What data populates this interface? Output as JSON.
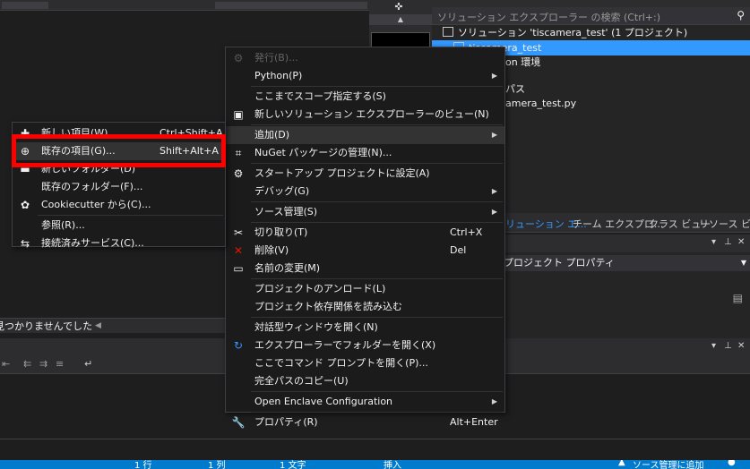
{
  "solution_explorer": {
    "search_placeholder": "ソリューション エクスプローラー の検索 (Ctrl+:)",
    "tree": [
      {
        "label": "ソリューション 'tiscamera_test' (1 プロジェクト)",
        "selected": false
      },
      {
        "label": "tiscamera_test",
        "selected": true
      },
      {
        "label": "on 環境",
        "selected": false
      },
      {
        "label": "パス",
        "selected": false
      },
      {
        "label": "amera_test.py",
        "selected": false
      }
    ]
  },
  "tool_tabs": [
    "リューション エ...",
    "チーム エクスプロ...",
    "クラス ビュー",
    "リソース ビュー"
  ],
  "properties": {
    "combo_value": "プロジェクト プロパティ"
  },
  "find_bar": {
    "text": "見つかりませんでした"
  },
  "status_bar": {
    "line": "1 行",
    "col": "1 列",
    "char": "1 文字",
    "mode": "挿入",
    "source_control": "ソース管理に追加"
  },
  "context_menu": [
    {
      "label": "発行(B)...",
      "shortcut": "",
      "icon": "publish-icon",
      "glyph": "⚙",
      "submenu": false,
      "disabled": true
    },
    {
      "label": "Python(P)",
      "shortcut": "",
      "icon": "",
      "glyph": "",
      "submenu": true,
      "disabled": false
    },
    {
      "separator": true
    },
    {
      "label": "ここまでスコープ指定する(S)",
      "shortcut": "",
      "icon": "",
      "glyph": "",
      "submenu": false,
      "disabled": false
    },
    {
      "label": "新しいソリューション エクスプローラーのビュー(N)",
      "shortcut": "",
      "icon": "new-view-icon",
      "glyph": "▣",
      "submenu": false,
      "disabled": false
    },
    {
      "separator": true
    },
    {
      "label": "追加(D)",
      "shortcut": "",
      "icon": "",
      "glyph": "",
      "submenu": true,
      "disabled": false,
      "highlighted": true
    },
    {
      "label": "NuGet パッケージの管理(N)...",
      "shortcut": "",
      "icon": "nuget-icon",
      "glyph": "⌗",
      "submenu": false,
      "disabled": false
    },
    {
      "separator": true
    },
    {
      "label": "スタートアップ プロジェクトに設定(A)",
      "shortcut": "",
      "icon": "startup-gear-icon",
      "glyph": "⚙",
      "submenu": false,
      "disabled": false
    },
    {
      "label": "デバッグ(G)",
      "shortcut": "",
      "icon": "",
      "glyph": "",
      "submenu": true,
      "disabled": false
    },
    {
      "separator": true
    },
    {
      "label": "ソース管理(S)",
      "shortcut": "",
      "icon": "",
      "glyph": "",
      "submenu": true,
      "disabled": false
    },
    {
      "separator": true
    },
    {
      "label": "切り取り(T)",
      "shortcut": "Ctrl+X",
      "icon": "cut-icon",
      "glyph": "✂",
      "submenu": false,
      "disabled": false
    },
    {
      "label": "削除(V)",
      "shortcut": "Del",
      "icon": "delete-icon",
      "glyph": "✕",
      "color": "#e51400",
      "submenu": false,
      "disabled": false
    },
    {
      "label": "名前の変更(M)",
      "shortcut": "",
      "icon": "rename-icon",
      "glyph": "▭",
      "submenu": false,
      "disabled": false
    },
    {
      "separator": true
    },
    {
      "label": "プロジェクトのアンロード(L)",
      "shortcut": "",
      "icon": "",
      "glyph": "",
      "submenu": false,
      "disabled": false
    },
    {
      "label": "プロジェクト依存関係を読み込む",
      "shortcut": "",
      "icon": "",
      "glyph": "",
      "submenu": false,
      "disabled": false
    },
    {
      "separator": true
    },
    {
      "label": "対話型ウィンドウを開く(N)",
      "shortcut": "",
      "icon": "",
      "glyph": "",
      "submenu": false,
      "disabled": false
    },
    {
      "label": "エクスプローラーでフォルダーを開く(X)",
      "shortcut": "",
      "icon": "refresh-arrow-icon",
      "glyph": "↻",
      "color": "#3794ff",
      "submenu": false,
      "disabled": false
    },
    {
      "label": "ここでコマンド プロンプトを開く(P)...",
      "shortcut": "",
      "icon": "",
      "glyph": "",
      "submenu": false,
      "disabled": false
    },
    {
      "label": "完全パスのコピー(U)",
      "shortcut": "",
      "icon": "",
      "glyph": "",
      "submenu": false,
      "disabled": false
    },
    {
      "separator": true
    },
    {
      "label": "Open Enclave Configuration",
      "shortcut": "",
      "icon": "",
      "glyph": "",
      "submenu": true,
      "disabled": false
    },
    {
      "separator": true
    },
    {
      "label": "プロパティ(R)",
      "shortcut": "Alt+Enter",
      "icon": "wrench-icon",
      "glyph": "🔧",
      "submenu": false,
      "disabled": false
    }
  ],
  "add_submenu": [
    {
      "label": "新しい項目(W)...",
      "shortcut": "Ctrl+Shift+A",
      "icon": "new-item-icon",
      "glyph": "✚"
    },
    {
      "label": "既存の項目(G)...",
      "shortcut": "Shift+Alt+A",
      "icon": "existing-item-icon",
      "glyph": "⊕",
      "highlighted": true
    },
    {
      "label": "新しいフォルダー(D)",
      "shortcut": "",
      "icon": "new-folder-icon",
      "glyph": "▬"
    },
    {
      "label": "既存のフォルダー(F)...",
      "shortcut": "",
      "icon": "",
      "glyph": ""
    },
    {
      "label": "Cookiecutter から(C)...",
      "shortcut": "",
      "icon": "cookiecutter-icon",
      "glyph": "✿"
    },
    {
      "separator": true
    },
    {
      "label": "参照(R)...",
      "shortcut": "",
      "icon": "",
      "glyph": ""
    },
    {
      "label": "接続済みサービス(C)...",
      "shortcut": "",
      "icon": "connected-service-icon",
      "glyph": "⇆"
    }
  ]
}
